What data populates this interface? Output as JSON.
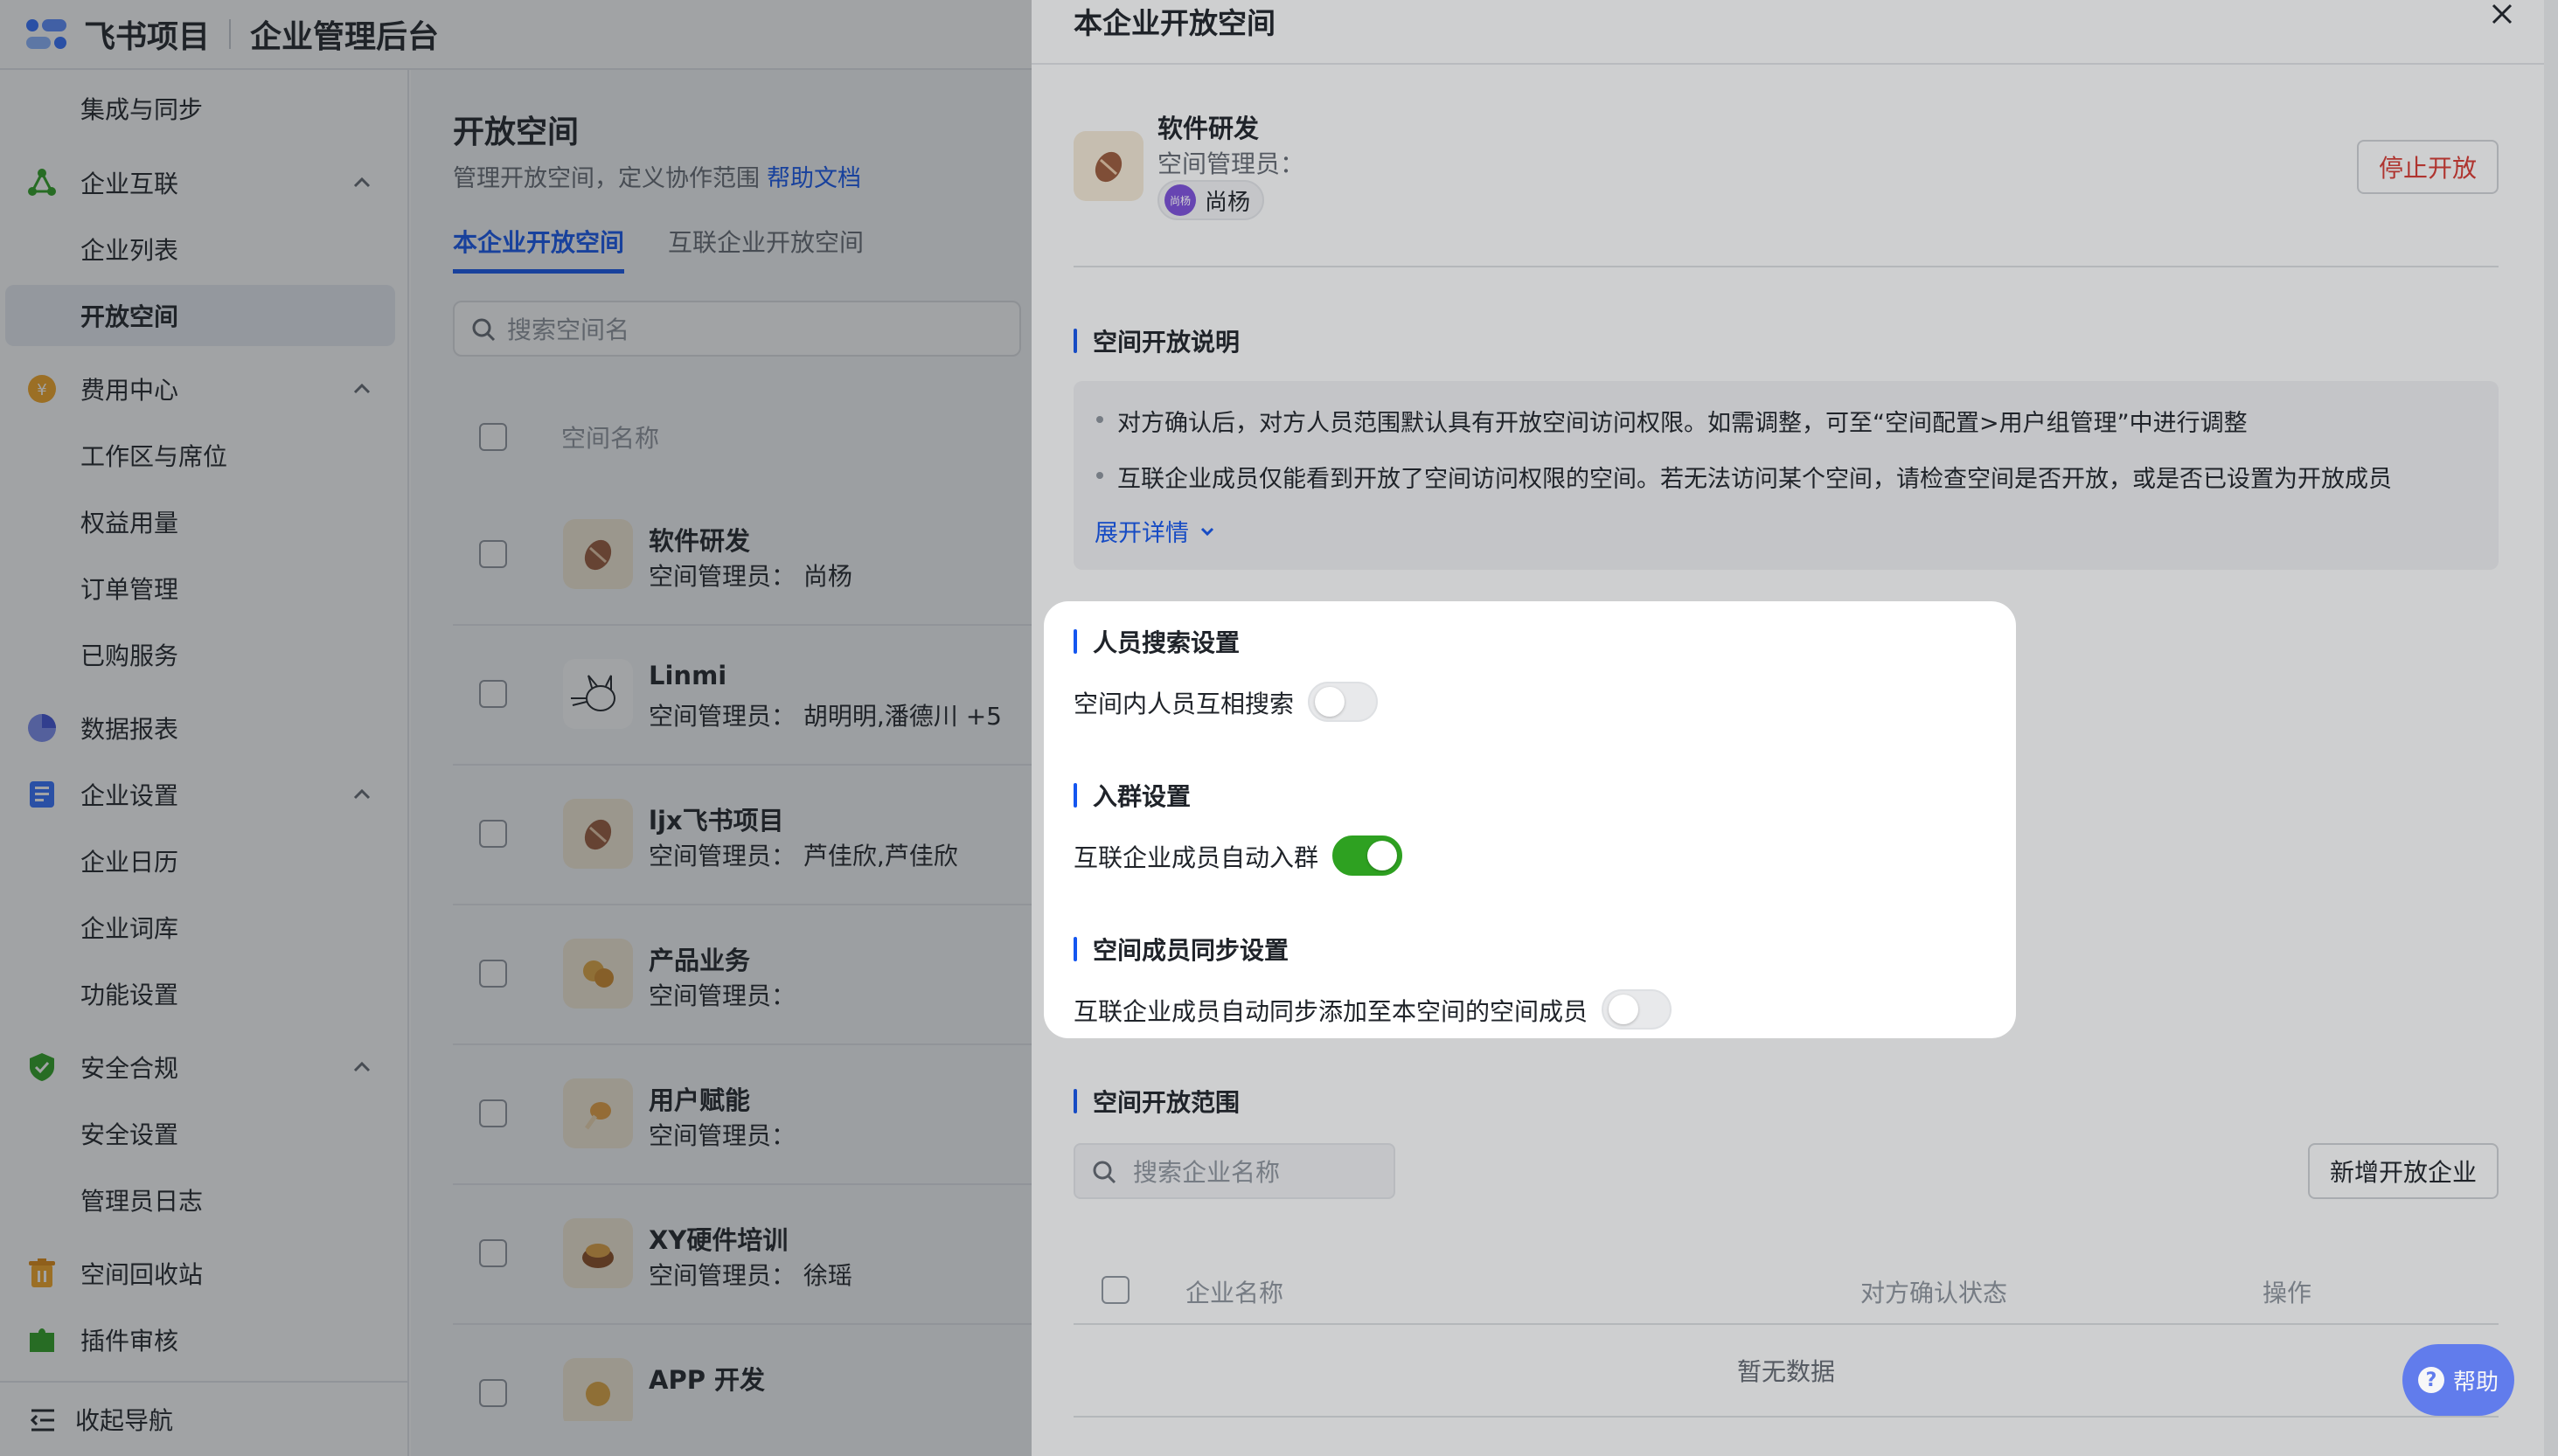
{
  "app": {
    "brand": "飞书项目",
    "section": "企业管理后台"
  },
  "sidebar": {
    "items": [
      {
        "label": "集成与同步",
        "kind": "sub"
      },
      {
        "label": "企业互联",
        "kind": "group",
        "icon": "network-icon"
      },
      {
        "label": "企业列表",
        "kind": "sub"
      },
      {
        "label": "开放空间",
        "kind": "sub",
        "active": true
      },
      {
        "label": "费用中心",
        "kind": "group",
        "icon": "coin-icon"
      },
      {
        "label": "工作区与席位",
        "kind": "sub"
      },
      {
        "label": "权益用量",
        "kind": "sub"
      },
      {
        "label": "订单管理",
        "kind": "sub"
      },
      {
        "label": "已购服务",
        "kind": "sub"
      },
      {
        "label": "数据报表",
        "kind": "group",
        "icon": "pie-chart-icon"
      },
      {
        "label": "企业设置",
        "kind": "group",
        "icon": "settings-book-icon"
      },
      {
        "label": "企业日历",
        "kind": "sub"
      },
      {
        "label": "企业词库",
        "kind": "sub"
      },
      {
        "label": "功能设置",
        "kind": "sub"
      },
      {
        "label": "安全合规",
        "kind": "group",
        "icon": "shield-check-icon"
      },
      {
        "label": "安全设置",
        "kind": "sub"
      },
      {
        "label": "管理员日志",
        "kind": "sub"
      },
      {
        "label": "空间回收站",
        "kind": "group",
        "icon": "trash-icon"
      },
      {
        "label": "插件审核",
        "kind": "group",
        "icon": "plugin-icon"
      }
    ],
    "collapse_label": "收起导航"
  },
  "main": {
    "title": "开放空间",
    "desc": "管理开放空间，定义协作范围",
    "help_link": "帮助文档",
    "tabs": [
      "本企业开放空间",
      "互联企业开放空间"
    ],
    "search_placeholder": "搜索空间名",
    "col_name": "空间名称",
    "rows": [
      {
        "name": "软件研发",
        "admin": "空间管理员：  尚杨"
      },
      {
        "name": "Linmi",
        "admin": "空间管理员：  胡明明,潘德川 +5"
      },
      {
        "name": "ljx飞书项目",
        "admin": "空间管理员：  芦佳欣,芦佳欣"
      },
      {
        "name": "产品业务",
        "admin": "空间管理员："
      },
      {
        "name": "用户赋能",
        "admin": "空间管理员："
      },
      {
        "name": "XY硬件培训",
        "admin": "空间管理员：  徐瑶"
      },
      {
        "name": "APP 开发",
        "admin": ""
      }
    ]
  },
  "drawer": {
    "title": "本企业开放空间",
    "space_name": "软件研发",
    "space_admin_label": "空间管理员：",
    "admin_chip_initials": "尚杨",
    "admin_chip_name": "尚杨",
    "stop_button": "停止开放",
    "notice_title": "空间开放说明",
    "notice_lines": [
      "对方确认后，对方人员范围默认具有开放空间访问权限。如需调整，可至“空间配置>用户组管理”中进行调整",
      "互联企业成员仅能看到开放了空间访问权限的空间。若无法访问某个空间，请检查空间是否开放，或是否已设置为开放成员"
    ],
    "expand_label": "展开详情",
    "search_setting_title": "人员搜索设置",
    "search_setting_label": "空间内人员互相搜索",
    "search_setting_on": false,
    "group_setting_title": "入群设置",
    "group_setting_label": "互联企业成员自动入群",
    "group_setting_on": true,
    "sync_setting_title": "空间成员同步设置",
    "sync_setting_label": "互联企业成员自动同步添加至本空间的空间成员",
    "sync_setting_on": false,
    "scope_title": "空间开放范围",
    "ent_search_placeholder": "搜索企业名称",
    "add_button": "新增开放企业",
    "col_company": "企业名称",
    "col_status": "对方确认状态",
    "col_action": "操作",
    "empty_text": "暂无数据"
  },
  "help": {
    "label": "帮助"
  },
  "colors": {
    "accent": "#1456f0",
    "toggle_on": "#2ea121",
    "danger": "#d83931"
  }
}
